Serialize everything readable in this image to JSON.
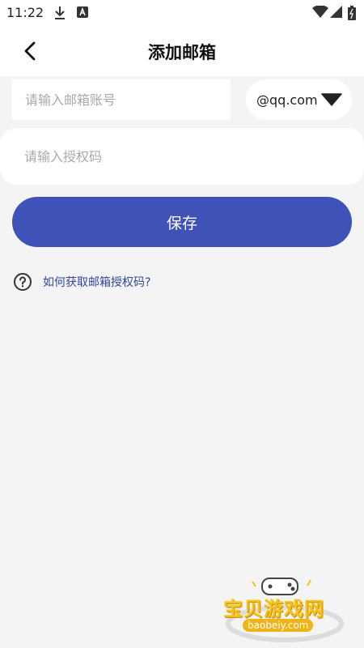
{
  "status_bar": {
    "time": "11:22",
    "icons": [
      "download-icon",
      "a-notification-icon",
      "wifi-icon",
      "signal-icon",
      "battery-icon"
    ]
  },
  "header": {
    "back_icon": "chevron-left-icon",
    "title": "添加邮箱"
  },
  "form": {
    "email_placeholder": "请输入邮箱账号",
    "email_value": "",
    "domain_selected": "@qq.com",
    "auth_placeholder": "请输入授权码",
    "auth_value": ""
  },
  "save_button": {
    "label": "保存"
  },
  "help": {
    "icon": "question-circle-icon",
    "link": "如何获取邮箱授权码?"
  },
  "watermark": {
    "title": "宝贝游戏网",
    "site": "baobeiy.com"
  },
  "colors": {
    "accent": "#3f52b7",
    "link": "#3346a0",
    "background": "#f4f4f4",
    "watermark_yellow": "#f6c216"
  }
}
